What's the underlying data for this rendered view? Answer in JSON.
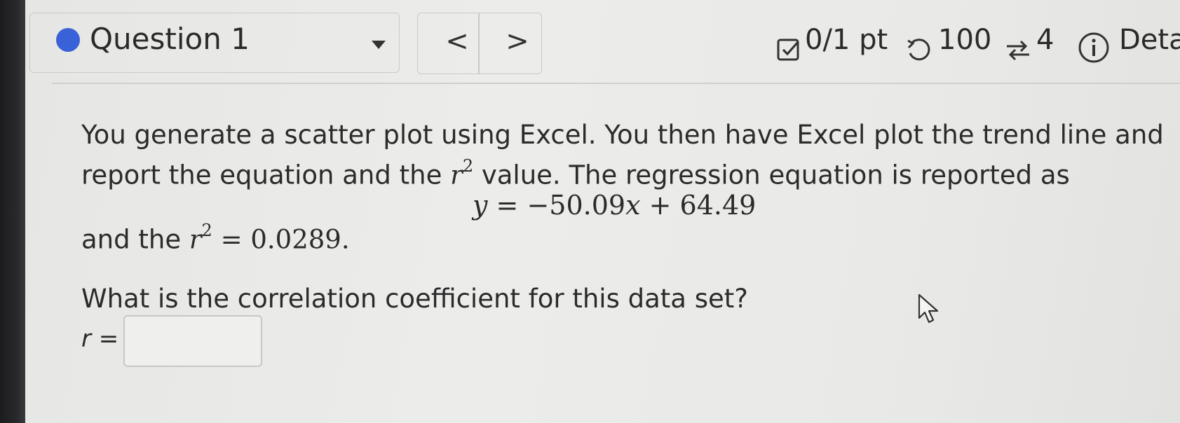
{
  "header": {
    "question_label": "Question 1",
    "prev_label": "<",
    "next_label": ">",
    "score": "0/1 pt",
    "retries": "100",
    "attempts": "4",
    "details": "Deta"
  },
  "question": {
    "p1_line1": "You generate a scatter plot using Excel. You then have Excel plot the trend line and",
    "p1_line2a": "report the equation and the",
    "p1_r": "r",
    "p1_exp": "2",
    "p1_line2b": "value. The regression equation is reported as",
    "eq_y": "y",
    "eq_eq": " = −50.09",
    "eq_x": "x",
    "eq_rest": " + 64.49",
    "p2_a": "and the",
    "p2_r": "r",
    "p2_exp": "2",
    "p2_val": " = 0.0289.",
    "prompt": "What is the correlation coefficient for this data set?",
    "answer_label": "r =",
    "answer_value": "",
    "answer_placeholder": ""
  },
  "colors": {
    "question_dot": "#3a62d8"
  },
  "icons": [
    "question-status-dot",
    "dropdown-caret-icon",
    "checkbox-icon",
    "retry-icon",
    "attempts-icon",
    "info-icon",
    "mouse-cursor-icon"
  ]
}
